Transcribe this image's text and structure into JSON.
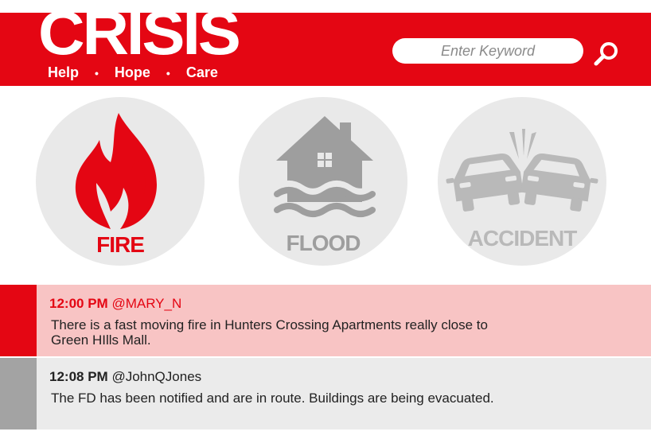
{
  "header": {
    "logo": "CRISIS",
    "tagline": [
      "Help",
      "Hope",
      "Care"
    ],
    "tagline_separator": "•",
    "search": {
      "placeholder": "Enter Keyword",
      "value": ""
    },
    "search_icon": "search-icon"
  },
  "categories": [
    {
      "label": "FIRE",
      "icon": "fire-icon",
      "color": "#e40613",
      "active": true
    },
    {
      "label": "FLOOD",
      "icon": "house-flood-icon",
      "color": "#9e9e9e",
      "active": false
    },
    {
      "label": "ACCIDENT",
      "icon": "car-crash-icon",
      "color": "#b9b9b9",
      "active": false
    }
  ],
  "feed": [
    {
      "time": "12:00 PM",
      "user": "@MARY_N",
      "text": "There is a fast moving fire in Hunters Crossing Apartments really close to Green HIlls Mall."
    },
    {
      "time": "12:08 PM",
      "user": "@JohnQJones",
      "text": "The FD has been notified and are in route. Buildings are being evacuated."
    }
  ],
  "colors": {
    "brand": "#e40613",
    "highlight": "#f8c4c4",
    "neutral": "#ebebeb",
    "circle": "#e9e9e9"
  }
}
